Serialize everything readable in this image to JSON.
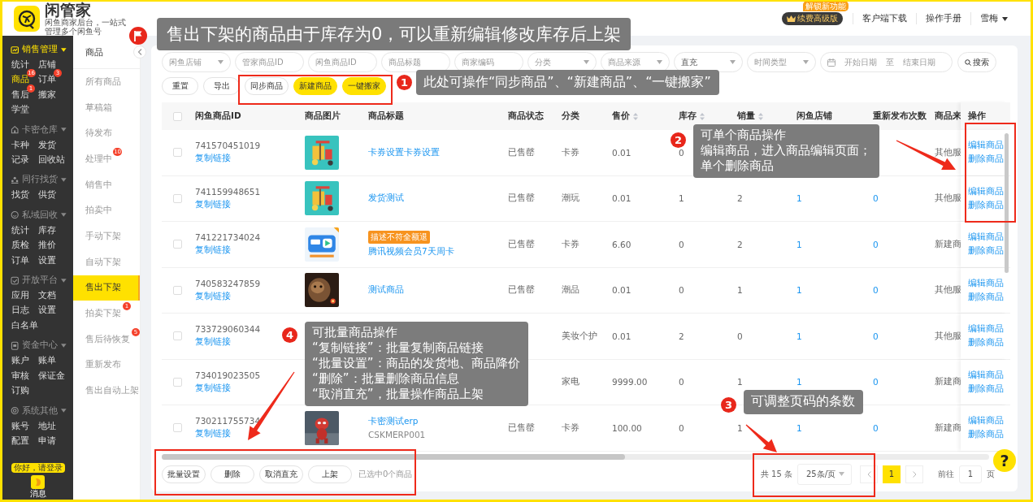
{
  "header": {
    "title": "闲管家",
    "subtitle": "闲鱼商家后台，一站式管理多个闲鱼号",
    "upgrade": {
      "label": "续费高级版",
      "badge": "解锁新功能"
    },
    "links": [
      "客户端下载",
      "操作手册"
    ],
    "user": "雪梅"
  },
  "sidebar": {
    "sections": [
      {
        "title": "销售管理",
        "active": true,
        "items": [
          {
            "label": "统计",
            "selected": false
          },
          {
            "label": "店铺",
            "selected": false
          },
          {
            "label": "商品",
            "selected": true,
            "badge": "16"
          },
          {
            "label": "订单",
            "selected": false,
            "badge": "3"
          },
          {
            "label": "售后",
            "selected": false,
            "badge": "1"
          },
          {
            "label": "搬家",
            "selected": false
          },
          {
            "label": "学堂",
            "selected": false
          }
        ]
      },
      {
        "title": "卡密仓库",
        "active": false,
        "items": [
          {
            "label": "卡种",
            "selected": false
          },
          {
            "label": "发货",
            "selected": false
          },
          {
            "label": "记录",
            "selected": false
          },
          {
            "label": "回收站",
            "selected": false
          }
        ]
      },
      {
        "title": "同行找货",
        "active": false,
        "items": [
          {
            "label": "找货",
            "selected": false
          },
          {
            "label": "供货",
            "selected": false
          }
        ]
      },
      {
        "title": "私域回收",
        "active": false,
        "items": [
          {
            "label": "统计",
            "selected": false
          },
          {
            "label": "库存",
            "selected": false
          },
          {
            "label": "质检",
            "selected": false
          },
          {
            "label": "推价",
            "selected": false
          },
          {
            "label": "订单",
            "selected": false
          },
          {
            "label": "设置",
            "selected": false
          }
        ]
      },
      {
        "title": "开放平台",
        "active": false,
        "items": [
          {
            "label": "应用",
            "selected": false
          },
          {
            "label": "文档",
            "selected": false
          },
          {
            "label": "日志",
            "selected": false
          },
          {
            "label": "设置",
            "selected": false
          },
          {
            "label": "白名单",
            "selected": false
          }
        ]
      },
      {
        "title": "资金中心",
        "active": false,
        "items": [
          {
            "label": "账户",
            "selected": false
          },
          {
            "label": "账单",
            "selected": false
          },
          {
            "label": "审核",
            "selected": false
          },
          {
            "label": "保证金",
            "selected": false
          },
          {
            "label": "订购",
            "selected": false
          }
        ]
      },
      {
        "title": "系统其他",
        "active": false,
        "items": [
          {
            "label": "账号",
            "selected": false
          },
          {
            "label": "地址",
            "selected": false
          },
          {
            "label": "配置",
            "selected": false
          },
          {
            "label": "申请",
            "selected": false
          }
        ]
      }
    ],
    "login_tip": "你好，请登录",
    "message": "消息"
  },
  "subnav": {
    "title": "商品",
    "items": [
      {
        "label": "所有商品",
        "selected": false
      },
      {
        "label": "草稿箱",
        "selected": false
      },
      {
        "label": "待发布",
        "selected": false
      },
      {
        "label": "处理中",
        "selected": false,
        "badge": "10"
      },
      {
        "label": "销售中",
        "selected": false
      },
      {
        "label": "拍卖中",
        "selected": false
      },
      {
        "label": "手动下架",
        "selected": false
      },
      {
        "label": "自动下架",
        "selected": false
      },
      {
        "label": "售出下架",
        "selected": true
      },
      {
        "label": "拍卖下架",
        "selected": false,
        "badge": "1"
      },
      {
        "label": "售后待恢复",
        "selected": false,
        "badge": "5"
      },
      {
        "label": "重新发布",
        "selected": false
      },
      {
        "label": "售出自动上架",
        "selected": false
      }
    ]
  },
  "filters": [
    {
      "kind": "select",
      "placeholder": "闲鱼店铺"
    },
    {
      "kind": "input",
      "placeholder": "管家商品ID"
    },
    {
      "kind": "input",
      "placeholder": "闲鱼商品ID"
    },
    {
      "kind": "input",
      "placeholder": "商品标题"
    },
    {
      "kind": "input",
      "placeholder": "商家编码"
    },
    {
      "kind": "select",
      "placeholder": "分类"
    },
    {
      "kind": "select",
      "placeholder": "商品来源"
    },
    {
      "kind": "select",
      "value": "直充"
    },
    {
      "kind": "select",
      "placeholder": "时间类型"
    }
  ],
  "date_range": {
    "start": "开始日期",
    "separator": "至",
    "end": "结束日期"
  },
  "search_button": "搜索",
  "actions": [
    {
      "label": "重置",
      "primary": false
    },
    {
      "label": "导出",
      "primary": false
    },
    {
      "label": "同步商品",
      "primary": false
    },
    {
      "label": "新建商品",
      "primary": true
    },
    {
      "label": "一键搬家",
      "primary": true
    }
  ],
  "table": {
    "select_all_checked": false,
    "columns": [
      {
        "label": "闲鱼商品ID",
        "sortable": false
      },
      {
        "label": "商品图片",
        "sortable": false
      },
      {
        "label": "商品标题",
        "sortable": false
      },
      {
        "label": "商品状态",
        "sortable": false
      },
      {
        "label": "分类",
        "sortable": false
      },
      {
        "label": "售价",
        "sortable": true
      },
      {
        "label": "库存",
        "sortable": true
      },
      {
        "label": "销量",
        "sortable": true
      },
      {
        "label": "闲鱼店铺",
        "sortable": false
      },
      {
        "label": "重新发布次数",
        "sortable": false
      },
      {
        "label": "商品来",
        "sortable": false
      },
      {
        "label": "操作",
        "sortable": false
      }
    ],
    "rows": [
      {
        "checked": false,
        "id": "741570451019",
        "copy_link": "复制链接",
        "image": true,
        "title": "卡券设置卡券设置",
        "status": "已售罄",
        "category": "卡券",
        "price": "0.01",
        "stock": "0",
        "source": "其他服",
        "actions": [
          "编辑商品",
          "删除商品"
        ]
      },
      {
        "checked": false,
        "id": "741159948651",
        "copy_link": "复制链接",
        "image": true,
        "title": "发货测试",
        "status": "已售罄",
        "category": "潮玩",
        "price": "0.01",
        "stock": "1",
        "sales": "2",
        "shop": "1",
        "republish": "0",
        "source": "其他服",
        "actions": [
          "编辑商品",
          "删除商品"
        ]
      },
      {
        "checked": false,
        "id": "741221734024",
        "copy_link": "复制链接",
        "image": true,
        "tag": "描述不符全额退",
        "title": "腾讯视频会员7天周卡",
        "status": "已售罄",
        "category": "卡券",
        "price": "6.60",
        "stock": "0",
        "sales": "2",
        "shop": "1",
        "republish": "0",
        "source": "新建商",
        "actions": [
          "编辑商品",
          "删除商品"
        ]
      },
      {
        "checked": false,
        "id": "740583247859",
        "copy_link": "复制链接",
        "image": true,
        "title": "测试商品",
        "status": "已售罄",
        "category": "潮品",
        "price": "0.01",
        "stock": "0",
        "sales": "1",
        "shop": "1",
        "republish": "0",
        "source": "其他服",
        "actions": [
          "编辑商品",
          "删除商品"
        ]
      },
      {
        "checked": false,
        "id": "733729060344",
        "copy_link": "复制链接",
        "image": false,
        "category": "美妆个护",
        "price": "0.01",
        "stock": "2",
        "sales": "0",
        "shop": "1",
        "republish": "0",
        "source": "其他服",
        "actions": [
          "编辑商品",
          "删除商品"
        ]
      },
      {
        "checked": false,
        "id": "734019023505",
        "copy_link": "复制链接",
        "image": false,
        "category": "家电",
        "price": "9999.00",
        "stock": "0",
        "sales": "1",
        "shop": "1",
        "republish": "0",
        "source": "新建商",
        "actions": [
          "编辑商品",
          "删除商品"
        ]
      },
      {
        "checked": false,
        "id": "730211755734",
        "copy_link": "复制链接",
        "image": true,
        "title": "卡密测试erp",
        "code": "CSKMERP001",
        "status": "已售罄",
        "category": "卡券",
        "price": "100.00",
        "stock": "0",
        "sales": "1",
        "shop": "1",
        "republish": "0",
        "source": "新建商",
        "actions": [
          "编辑商品",
          "删除商品"
        ]
      }
    ]
  },
  "batch_actions": [
    "批量设置",
    "删除",
    "取消直充",
    "上架"
  ],
  "selection_info": "已选中0个商品",
  "pagination": {
    "total": "共 15 条",
    "page_size": "25条/页",
    "pages": [
      {
        "label": "1",
        "selected": true
      }
    ],
    "goto_label": "前往",
    "goto_value": "1",
    "goto_suffix": "页"
  },
  "help": "?",
  "annotations": {
    "banner": "售出下架的商品由于库存为0，可以重新编辑修改库存后上架",
    "notes": [
      {
        "number": "1",
        "lines": [
          "此处可操作“同步商品”、“新建商品”、“一键搬家”"
        ]
      },
      {
        "number": "2",
        "lines": [
          "可单个商品操作",
          "编辑商品，进入商品编辑页面；",
          "单个删除商品"
        ]
      },
      {
        "number": "4",
        "lines": [
          "可批量商品操作",
          "“复制链接”：批量复制商品链接",
          "“批量设置”：商品的发货地、商品降价",
          "“删除”：批量删除商品信息",
          "“取消直充”，批量操作商品上架"
        ]
      },
      {
        "number": "3",
        "lines": [
          "可调整页码的条数"
        ]
      }
    ]
  }
}
